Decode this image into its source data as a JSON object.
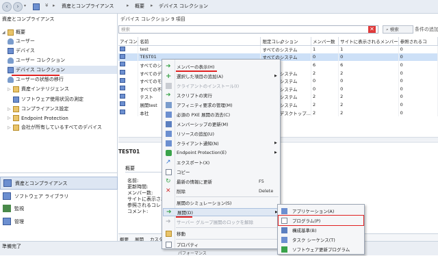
{
  "addressbar": {
    "root_glyph": "¥",
    "crumbs": [
      "資産とコンプライアンス",
      "概要",
      "デバイス コレクション"
    ]
  },
  "leftpane": {
    "title": "資産とコンプライアンス",
    "items": [
      {
        "label": "概要"
      },
      {
        "label": "ユーザー"
      },
      {
        "label": "デバイス"
      },
      {
        "label": "ユーザー コレクション"
      },
      {
        "label": "デバイス コレクション"
      },
      {
        "label": "ユーザーの状態の移行"
      },
      {
        "label": "資産インテリジェンス"
      },
      {
        "label": "ソフトウェア使用状況の測定"
      },
      {
        "label": "コンプライアンス設定"
      },
      {
        "label": "Endpoint Protection"
      },
      {
        "label": "会社が所有しているすべてのデバイス"
      }
    ],
    "workspaces": [
      {
        "label": "資産とコンプライアンス"
      },
      {
        "label": "ソフトウェア ライブラリ"
      },
      {
        "label": "監視"
      },
      {
        "label": "管理"
      }
    ]
  },
  "rightpane": {
    "header": "デバイス コレクション 9 項目",
    "search_placeholder": "検索",
    "search_button": "検索",
    "add_criteria": "条件の追加",
    "columns": [
      "アイコン",
      "名前",
      "限定コレクション",
      "メンバー数",
      "サイトに表示されるメンバー",
      "参照されるコ"
    ],
    "rows": [
      {
        "name": "test",
        "limit": "すべてのシステム",
        "members": "1",
        "site": "1",
        "ref": "0"
      },
      {
        "name": "TEST01",
        "limit": "すべてのシステム",
        "members": "0",
        "site": "0",
        "ref": "0"
      },
      {
        "name": "すべてのシ",
        "limit": "",
        "members": "6",
        "site": "6",
        "ref": "0"
      },
      {
        "name": "すべてのデ",
        "limit": "すべてのシステム",
        "members": "2",
        "site": "2",
        "ref": "0"
      },
      {
        "name": "すべてのモ",
        "limit": "すべてのシステム",
        "members": "0",
        "site": "0",
        "ref": "0"
      },
      {
        "name": "すべての不",
        "limit": "すべてのシステム",
        "members": "0",
        "site": "0",
        "ref": "0"
      },
      {
        "name": "テスト",
        "limit": "すべてのシステム",
        "members": "2",
        "site": "2",
        "ref": "0"
      },
      {
        "name": "展開test",
        "limit": "すべてのシステム",
        "members": "2",
        "site": "2",
        "ref": "0"
      },
      {
        "name": "本社",
        "limit": "すべてのデスクトップ...",
        "members": "2",
        "site": "2",
        "ref": "0"
      }
    ]
  },
  "detail": {
    "title": "TEST01",
    "section": "概要",
    "fields": [
      "名前:",
      "更新時間:",
      "メンバー数:",
      "サイトに表示される",
      "参照されるコレク",
      "コメント:"
    ],
    "tabs": [
      "概要",
      "展開",
      "カスタム"
    ]
  },
  "context_menu": {
    "items": [
      {
        "label": "メンバーの表示(H)",
        "shortcut": "",
        "arrow": false,
        "disabled": false,
        "icon": "members-icon"
      },
      {
        "label": "選択した項目の追加(A)",
        "shortcut": "",
        "arrow": true,
        "disabled": false,
        "icon": "add-icon"
      },
      {
        "label": "クライアントのインストール(I)",
        "shortcut": "",
        "arrow": false,
        "disabled": true,
        "icon": "install-icon"
      },
      {
        "label": "スクリプトの実行",
        "shortcut": "",
        "arrow": false,
        "disabled": false,
        "icon": "script-icon"
      },
      {
        "label": "アフィニティ要求の管理(M)",
        "shortcut": "",
        "arrow": false,
        "disabled": false,
        "icon": "affinity-icon"
      },
      {
        "label": "必須の PXE 展開の消去(C)",
        "shortcut": "",
        "arrow": false,
        "disabled": false,
        "icon": "pxe-icon"
      },
      {
        "label": "メンバーシップの更新(M)",
        "shortcut": "",
        "arrow": false,
        "disabled": false,
        "icon": "refresh-icon"
      },
      {
        "label": "リソースの追加(U)",
        "shortcut": "",
        "arrow": false,
        "disabled": false,
        "icon": "resource-icon"
      },
      {
        "label": "クライアント通知(N)",
        "shortcut": "",
        "arrow": true,
        "disabled": false,
        "icon": "notify-icon"
      },
      {
        "label": "Endpoint Protection(E)",
        "shortcut": "",
        "arrow": true,
        "disabled": false,
        "icon": "shield-icon"
      },
      {
        "label": "エクスポート(X)",
        "shortcut": "",
        "arrow": false,
        "disabled": false,
        "icon": "export-icon"
      },
      {
        "label": "コピー",
        "shortcut": "",
        "arrow": false,
        "disabled": false,
        "icon": "copy-icon"
      },
      {
        "label": "最新の情報に更新",
        "shortcut": "F5",
        "arrow": false,
        "disabled": false,
        "icon": "reload-icon"
      },
      {
        "label": "削除",
        "shortcut": "Delete",
        "arrow": false,
        "disabled": false,
        "icon": "delete-icon"
      },
      {
        "label": "展開のシミュレーション(S)",
        "shortcut": "",
        "arrow": false,
        "disabled": false,
        "icon": "simulate-icon"
      },
      {
        "label": "展開(D)",
        "shortcut": "",
        "arrow": true,
        "disabled": false,
        "icon": "deploy-icon"
      },
      {
        "label": "サーバー グループ展開のロックを解除",
        "shortcut": "",
        "arrow": false,
        "disabled": true,
        "icon": "unlock-icon"
      },
      {
        "label": "移動",
        "shortcut": "",
        "arrow": false,
        "disabled": false,
        "icon": "move-icon"
      },
      {
        "label": "プロパティ",
        "shortcut": "",
        "arrow": false,
        "disabled": false,
        "icon": "properties-icon"
      }
    ]
  },
  "submenu": {
    "items": [
      {
        "label": "アプリケーション(A)"
      },
      {
        "label": "プログラム(P)"
      },
      {
        "label": "構成基準(B)"
      },
      {
        "label": "タスク シーケンス(T)"
      },
      {
        "label": "ソフトウェア更新プログラム"
      }
    ]
  },
  "status": {
    "text": "準備完了",
    "bottom_fragment": "パフォーマンス"
  },
  "colors": {
    "highlight": "#e02020",
    "selection": "#cde0f7",
    "green_arrow": "#3aa34a"
  }
}
